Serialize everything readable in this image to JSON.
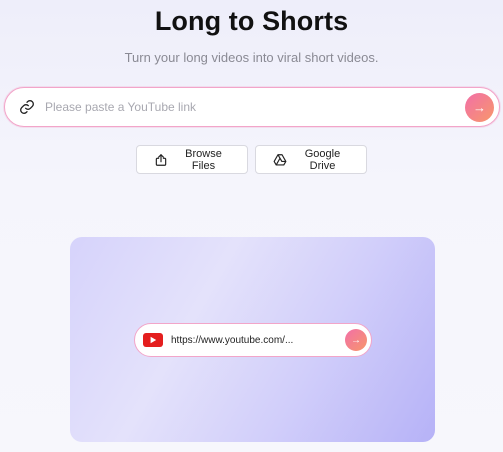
{
  "header": {
    "title": "Long to Shorts",
    "subtitle": "Turn your long videos into viral short videos."
  },
  "url_input": {
    "placeholder": "Please paste a YouTube link",
    "value": "",
    "submit_icon": "arrow-right-icon",
    "leading_icon": "link-icon"
  },
  "actions": {
    "browse_label": "Browse Files",
    "browse_icon": "upload-icon",
    "drive_label": "Google Drive",
    "drive_icon": "google-drive-icon"
  },
  "preview": {
    "url_text": "https://www.youtube.com/...",
    "source_icon": "youtube-icon",
    "submit_icon": "arrow-right-icon"
  },
  "colors": {
    "accent_start": "#f26fa8",
    "accent_end": "#f7976a",
    "input_border": "#f2a5c9",
    "preview_bg": "#d6d3fb"
  }
}
